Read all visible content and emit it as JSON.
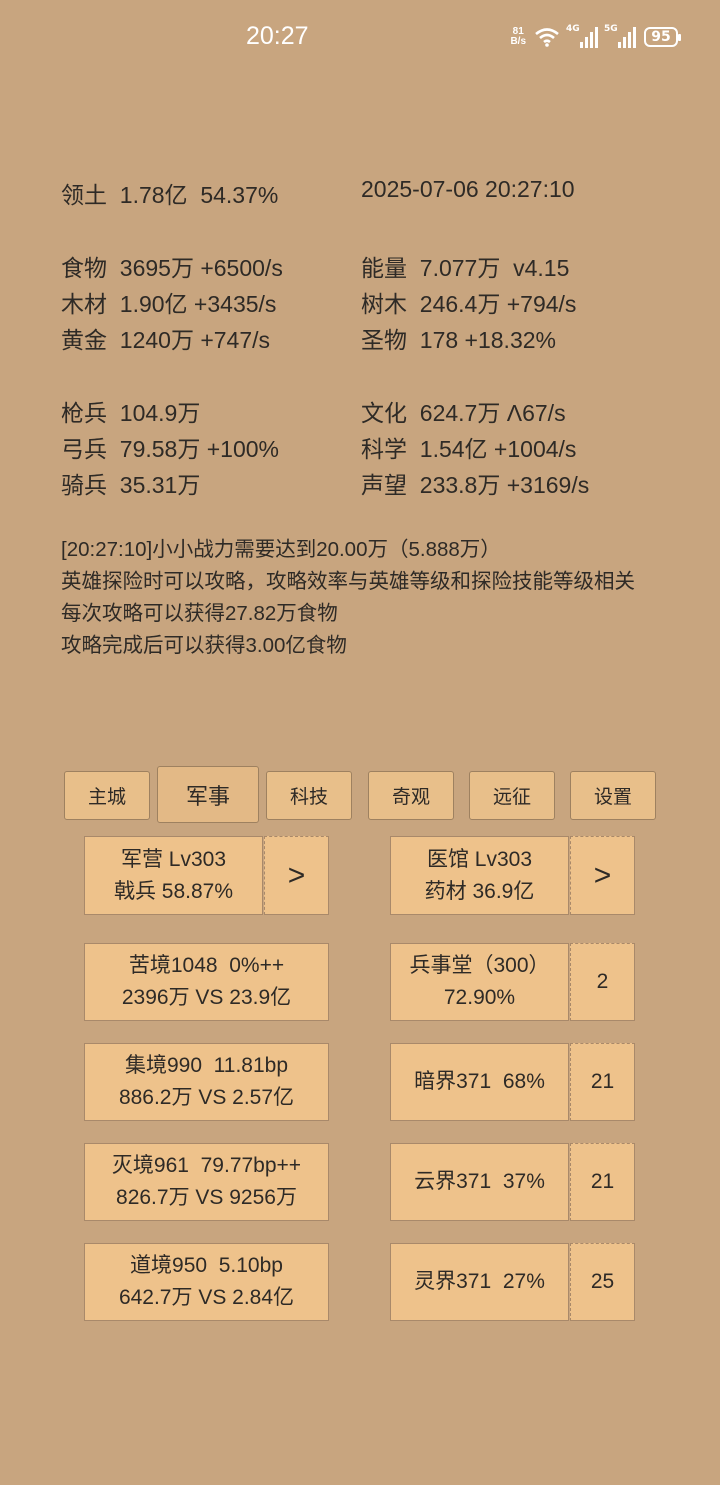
{
  "status_bar": {
    "time": "20:27",
    "net_speed_value": "81",
    "net_speed_unit": "B/s",
    "signal1_label": "4G",
    "signal2_label": "5G",
    "battery": "95"
  },
  "stats": {
    "territory": "领土  1.78亿  54.37%",
    "datetime": "2025-07-06 20:27:10",
    "food": "食物  3695万 +6500/s",
    "energy": "能量  7.077万  v4.15",
    "wood": "木材  1.90亿 +3435/s",
    "trees": "树木  246.4万 +794/s",
    "gold": "黄金  1240万 +747/s",
    "relics": "圣物  178 +18.32%",
    "spearmen": "枪兵  104.9万",
    "culture": "文化  624.7万 Λ67/s",
    "archers": "弓兵  79.58万 +100%",
    "science": "科学  1.54亿 +1004/s",
    "cavalry": "骑兵  35.31万",
    "prestige": "声望  233.8万 +3169/s"
  },
  "messages": [
    "[20:27:10]小小战力需要达到20.00万（5.888万）",
    "英雄探险时可以攻略，攻略效率与英雄等级和探险技能等级相关",
    "每次攻略可以获得27.82万食物",
    "攻略完成后可以获得3.00亿食物"
  ],
  "tabs": {
    "main_city": "主城",
    "military": "军事",
    "tech": "科技",
    "wonders": "奇观",
    "expedition": "远征",
    "settings": "设置"
  },
  "buttons": {
    "barracks_line1": "军营 Lv303",
    "barracks_line2": "戟兵 58.87%",
    "barracks_arrow": ">",
    "clinic_line1": "医馆 Lv303",
    "clinic_line2": "药材 36.9亿",
    "clinic_arrow": ">",
    "realm1_line1": "苦境1048  0%++",
    "realm1_line2": "2396万 VS 23.9亿",
    "realm2_line1": "集境990  11.81bp",
    "realm2_line2": "886.2万 VS 2.57亿",
    "realm3_line1": "灭境961  79.77bp++",
    "realm3_line2": "826.7万 VS 9256万",
    "realm4_line1": "道境950  5.10bp",
    "realm4_line2": "642.7万 VS 2.84亿",
    "hall_line1": "兵事堂（300）",
    "hall_line2": "72.90%",
    "hall_count": "2",
    "dark_realm": "暗界371  68%",
    "dark_count": "21",
    "cloud_realm": "云界371  37%",
    "cloud_count": "21",
    "spirit_realm": "灵界371  27%",
    "spirit_count": "25"
  }
}
